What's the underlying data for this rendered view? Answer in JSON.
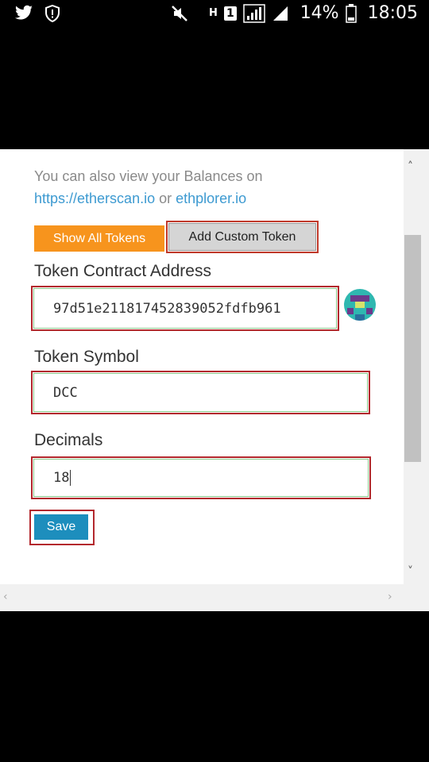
{
  "status_bar": {
    "battery": "14%",
    "time": "18:05",
    "sim_slot": "1",
    "network_label": "H",
    "icons": [
      "twitter-icon",
      "alert-shield-icon",
      "mute-icon",
      "signal-icon",
      "battery-icon"
    ]
  },
  "info": {
    "text_prefix": "You can also view your Balances on",
    "link1": "https://etherscan.io",
    "connector": " or ",
    "link2": "ethplorer.io"
  },
  "tabs": {
    "show_all": "Show All Tokens",
    "add_custom": "Add Custom Token"
  },
  "form": {
    "address_label": "Token Contract Address",
    "address_value": "97d51e211817452839052fdfb961",
    "symbol_label": "Token Symbol",
    "symbol_value": "DCC",
    "decimals_label": "Decimals",
    "decimals_value": "18",
    "save_label": "Save"
  },
  "colors": {
    "orange": "#f7941d",
    "save_blue": "#1d8ebd",
    "highlight_red": "#b3282d",
    "link_blue": "#3d9ad1"
  }
}
